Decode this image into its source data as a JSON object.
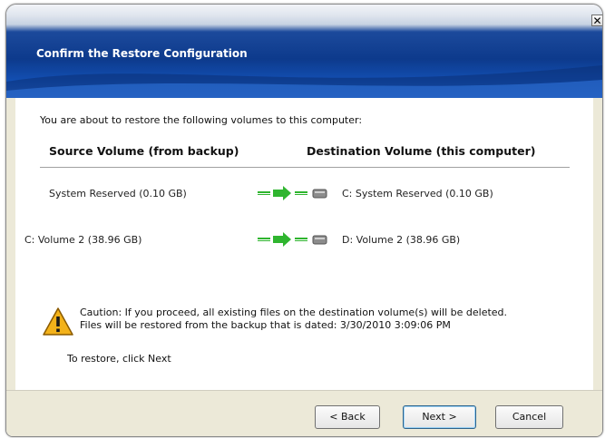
{
  "dialog": {
    "title": "Confirm the Restore Configuration",
    "close_glyph": "✕"
  },
  "body": {
    "intro": "You are about to restore the following volumes to this computer:",
    "source_header": "Source Volume (from backup)",
    "destination_header": "Destination Volume (this computer)",
    "volumes": [
      {
        "source": "System Reserved (0.10 GB)",
        "destination": "C: System Reserved (0.10 GB)"
      },
      {
        "source": "C: Volume 2 (38.96 GB)",
        "destination": "D: Volume 2 (38.96 GB)"
      }
    ],
    "caution_line1": "Caution: If you proceed, all existing files on the destination volume(s) will be deleted.",
    "caution_line2": "Files will be restored from the backup that is dated: 3/30/2010 3:09:06 PM",
    "restore_hint": "To restore, click Next"
  },
  "buttons": {
    "back": "< Back",
    "next": "Next >",
    "cancel": "Cancel"
  },
  "colors": {
    "arrow_green": "#2fb52f",
    "title_blue": "#0d3a8c",
    "warning_yellow": "#f3b21a"
  },
  "icons": {
    "arrow": "green-arrow-icon",
    "drive": "hard-drive-icon",
    "warning": "warning-triangle-icon"
  }
}
